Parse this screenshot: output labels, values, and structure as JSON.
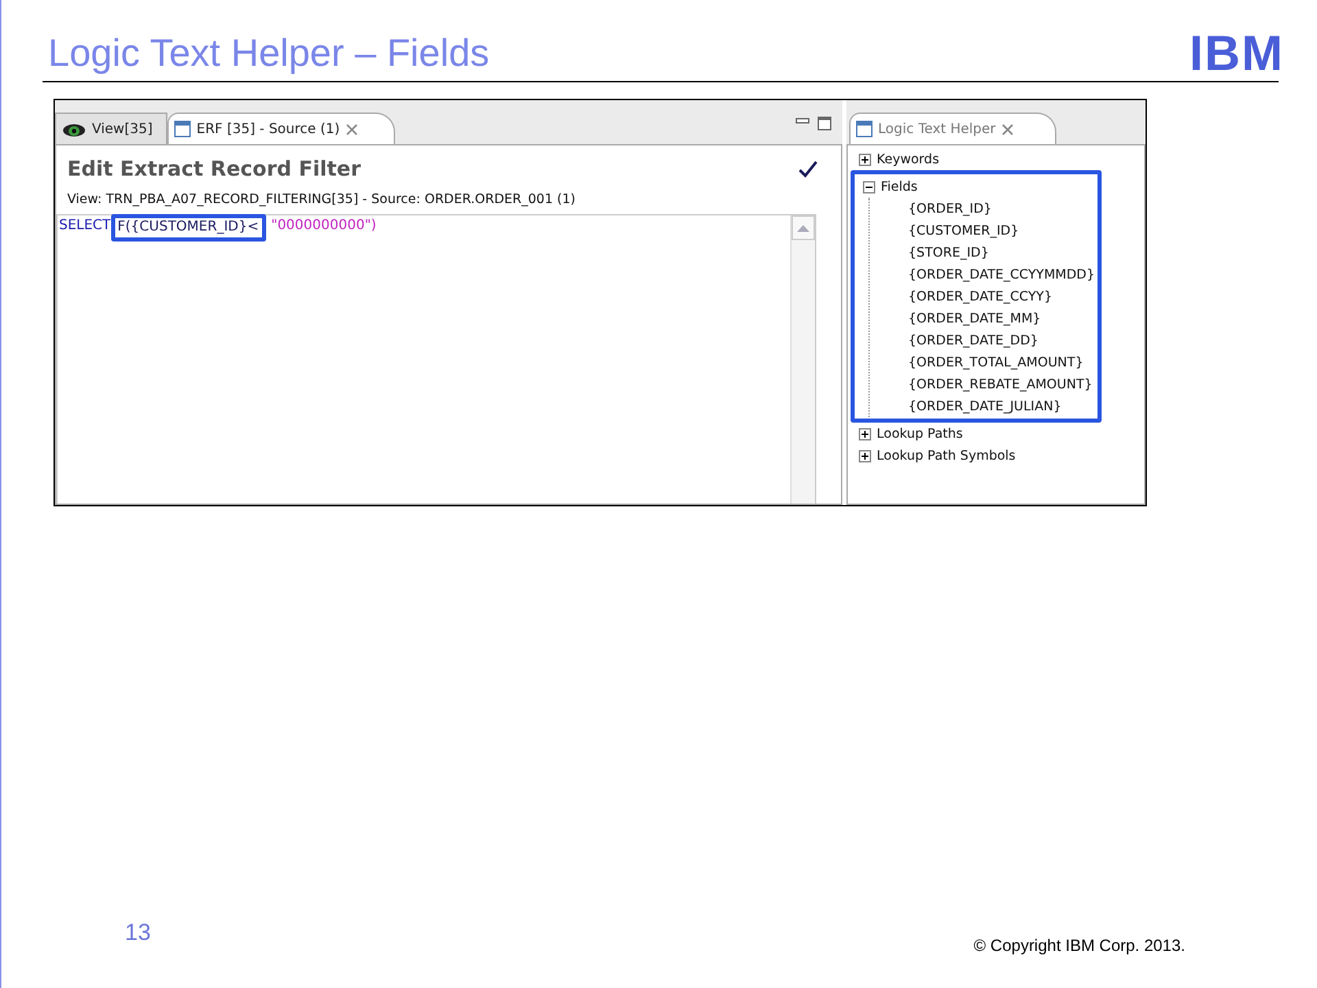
{
  "slide": {
    "title": "Logic Text Helper – Fields",
    "logo": "IBM",
    "page_number": "13",
    "copyright": "© Copyright  IBM Corp. 2013."
  },
  "editor": {
    "tabs": [
      {
        "label": "View[35]",
        "selected": false,
        "kind": "view"
      },
      {
        "label": "ERF [35] - Source (1)",
        "selected": true,
        "kind": "editor"
      }
    ],
    "heading": "Edit Extract Record Filter",
    "subtitle": "View: TRN_PBA_A07_RECORD_FILTERING[35] - Source: ORDER.ORDER_001 (1)",
    "code": {
      "keyword": "SELECT",
      "highlighted": "F({CUSTOMER_ID}<",
      "string": "\"0000000000\")"
    }
  },
  "helper": {
    "tab": "Logic Text Helper",
    "tree": [
      {
        "label": "Keywords",
        "expanded": false,
        "highlighted": false
      },
      {
        "label": "Fields",
        "expanded": true,
        "highlighted": true,
        "children": [
          {
            "label": "{ORDER_ID}"
          },
          {
            "label": "{CUSTOMER_ID}"
          },
          {
            "label": "{STORE_ID}"
          },
          {
            "label": "{ORDER_DATE_CCYYMMDD}"
          },
          {
            "label": "{ORDER_DATE_CCYY}"
          },
          {
            "label": "{ORDER_DATE_MM}"
          },
          {
            "label": "{ORDER_DATE_DD}"
          },
          {
            "label": "{ORDER_TOTAL_AMOUNT}"
          },
          {
            "label": "{ORDER_REBATE_AMOUNT}"
          },
          {
            "label": "{ORDER_DATE_JULIAN}"
          }
        ]
      },
      {
        "label": "Lookup Paths",
        "expanded": false,
        "highlighted": false
      },
      {
        "label": "Lookup Path Symbols",
        "expanded": false,
        "highlighted": false
      }
    ]
  }
}
